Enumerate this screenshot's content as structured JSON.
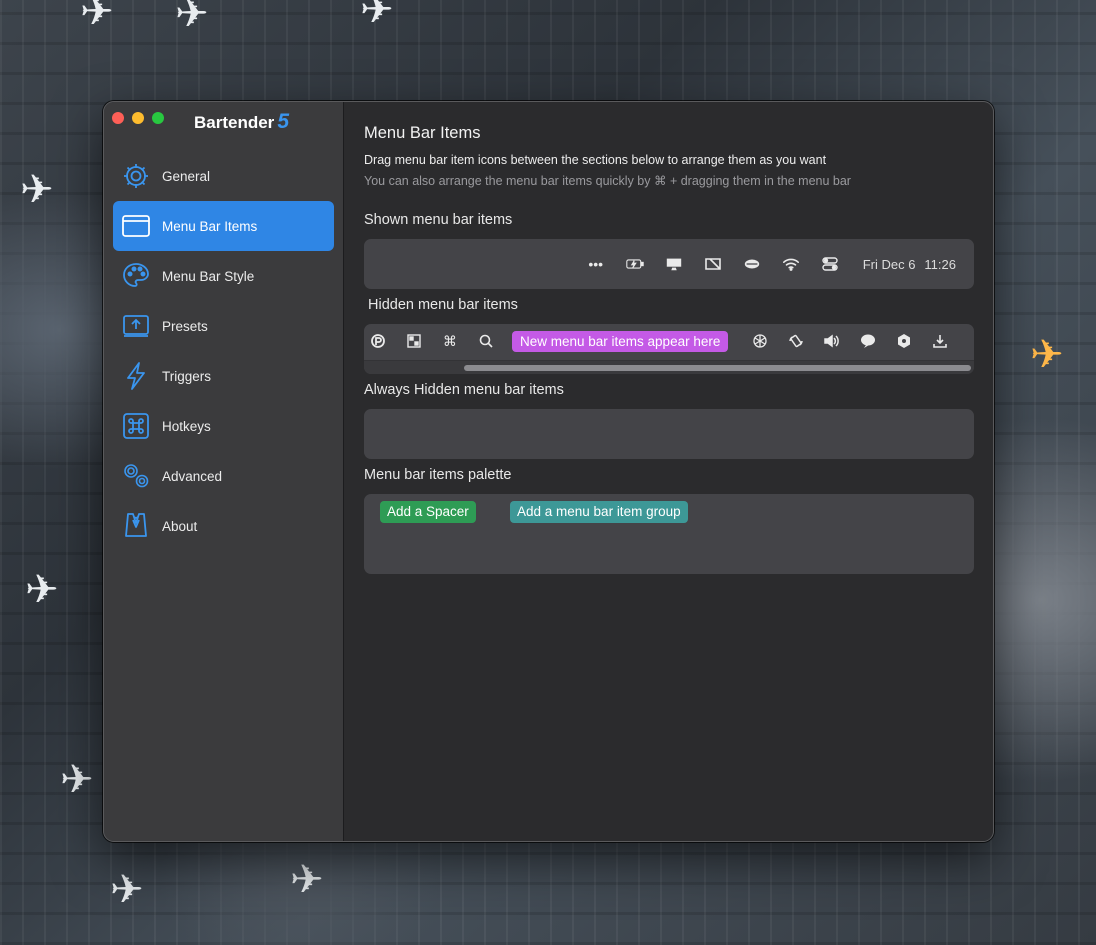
{
  "app": {
    "name": "Bartender",
    "version": "5"
  },
  "sidebar": {
    "items": [
      {
        "label": "General",
        "icon": "gear-icon"
      },
      {
        "label": "Menu Bar Items",
        "icon": "window-icon",
        "active": true
      },
      {
        "label": "Menu Bar Style",
        "icon": "palette-icon"
      },
      {
        "label": "Presets",
        "icon": "upload-tray-icon"
      },
      {
        "label": "Triggers",
        "icon": "lightning-icon"
      },
      {
        "label": "Hotkeys",
        "icon": "command-key-icon"
      },
      {
        "label": "Advanced",
        "icon": "gears-icon"
      },
      {
        "label": "About",
        "icon": "bartender-vest-icon"
      }
    ]
  },
  "main": {
    "title": "Menu Bar Items",
    "description": "Drag menu bar item icons between the sections below to arrange them as you want",
    "hint": "You can also arrange the menu bar items quickly by ⌘ + dragging them in the menu bar",
    "sections": {
      "shown": {
        "label": "Shown menu bar items",
        "icons": [
          "more-dots-icon",
          "battery-icon",
          "display-icon",
          "stage-manager-icon",
          "cloud-icon",
          "wifi-icon",
          "control-center-icon"
        ],
        "clock_date": "Fri Dec 6",
        "clock_time": "11:26"
      },
      "hidden": {
        "label": "Hidden menu bar items",
        "icons_left": [
          "paste-app-icon",
          "qr-icon",
          "command-icon",
          "search-icon"
        ],
        "new_items_label": "New menu bar items appear here",
        "icons_right": [
          "openai-icon",
          "rotate-icon",
          "volume-icon",
          "line-app-icon",
          "shield-icon",
          "download-tray-icon"
        ]
      },
      "always_hidden": {
        "label": "Always Hidden menu bar items"
      },
      "palette": {
        "label": "Menu bar items palette",
        "add_spacer": "Add a Spacer",
        "add_group": "Add a menu bar item group"
      }
    }
  },
  "colors": {
    "accent": "#2f86e5",
    "new_items_badge": "#c45ae6",
    "spacer_button": "#2e9c55",
    "group_button": "#3d9897",
    "brand_version": "#3a95ee"
  }
}
